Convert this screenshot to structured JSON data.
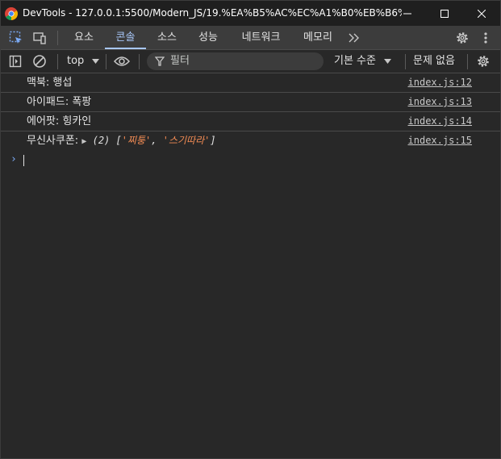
{
  "window": {
    "title": "DevTools - 127.0.0.1:5500/Modern_JS/19.%EA%B5%AC%EC%A1%B0%EB%B6%84...",
    "icon": "chrome-icon"
  },
  "tabs": [
    {
      "label": "요소",
      "active": false
    },
    {
      "label": "콘솔",
      "active": true
    },
    {
      "label": "소스",
      "active": false
    },
    {
      "label": "성능",
      "active": false
    },
    {
      "label": "네트워크",
      "active": false
    },
    {
      "label": "메모리",
      "active": false
    }
  ],
  "toolbar": {
    "context": "top",
    "filter_placeholder": "필터",
    "levels": "기본 수준",
    "issues": "문제 없음"
  },
  "console": {
    "messages": [
      {
        "text": "맥북: 행섭",
        "source": "index.js:12"
      },
      {
        "text": "아이패드: 폭팡",
        "source": "index.js:13"
      },
      {
        "text": "에어팟: 힝카인",
        "source": "index.js:14"
      },
      {
        "label": "무신사쿠폰:",
        "array_length": "(2)",
        "items": [
          "'찌퉁'",
          "'스기따라'"
        ],
        "source": "index.js:15"
      }
    ],
    "prompt": "›"
  },
  "colors": {
    "background": "#282828",
    "accent": "#a8c7fa",
    "string": "#f28b54",
    "prompt": "#7cacf8"
  }
}
